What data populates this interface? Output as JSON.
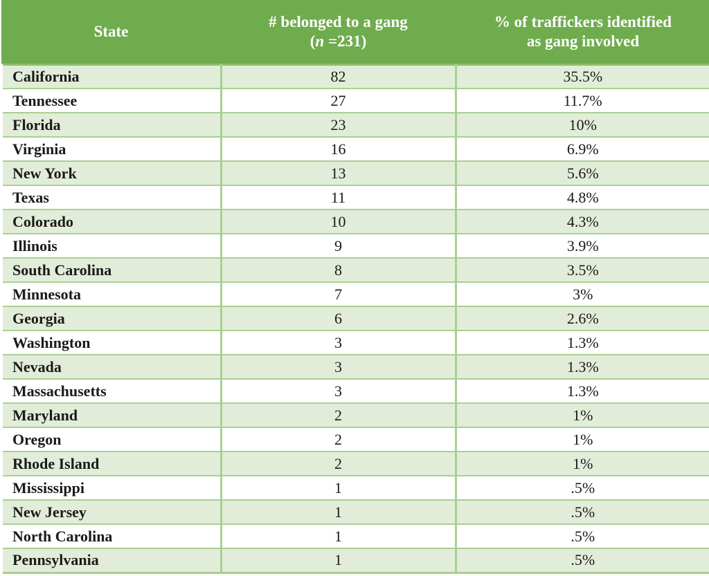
{
  "table": {
    "columns": [
      {
        "key": "state",
        "header_lines": [
          "State"
        ],
        "align": "left"
      },
      {
        "key": "count",
        "header_lines": [
          "# belonged to a gang",
          "(n =231)"
        ],
        "header_line2_prefix": "(",
        "header_line2_italic": "n",
        "header_line2_suffix": " =231)",
        "align": "center"
      },
      {
        "key": "percent",
        "header_lines": [
          "% of traffickers identified",
          "as gang involved"
        ],
        "align": "center"
      }
    ],
    "sample_size": "231",
    "colors": {
      "header_green": "#6fac4d",
      "row_alt_green": "#e2edd9",
      "row_base_white": "#ffffff",
      "gridline_green": "#a9cf92",
      "header_text": "#ffffff",
      "body_text": "#1a1a1a"
    },
    "rows": [
      {
        "state": "California",
        "count": "82",
        "percent": "35.5%"
      },
      {
        "state": "Tennessee",
        "count": "27",
        "percent": "11.7%"
      },
      {
        "state": "Florida",
        "count": "23",
        "percent": "10%"
      },
      {
        "state": "Virginia",
        "count": "16",
        "percent": "6.9%"
      },
      {
        "state": "New York",
        "count": "13",
        "percent": "5.6%"
      },
      {
        "state": "Texas",
        "count": "11",
        "percent": "4.8%"
      },
      {
        "state": "Colorado",
        "count": "10",
        "percent": "4.3%"
      },
      {
        "state": "Illinois",
        "count": "9",
        "percent": "3.9%"
      },
      {
        "state": "South Carolina",
        "count": "8",
        "percent": "3.5%"
      },
      {
        "state": "Minnesota",
        "count": "7",
        "percent": "3%"
      },
      {
        "state": "Georgia",
        "count": "6",
        "percent": "2.6%"
      },
      {
        "state": "Washington",
        "count": "3",
        "percent": "1.3%"
      },
      {
        "state": "Nevada",
        "count": "3",
        "percent": "1.3%"
      },
      {
        "state": "Massachusetts",
        "count": "3",
        "percent": "1.3%"
      },
      {
        "state": "Maryland",
        "count": "2",
        "percent": "1%"
      },
      {
        "state": "Oregon",
        "count": "2",
        "percent": "1%"
      },
      {
        "state": "Rhode Island",
        "count": "2",
        "percent": "1%"
      },
      {
        "state": "Mississippi",
        "count": "1",
        "percent": ".5%"
      },
      {
        "state": "New Jersey",
        "count": "1",
        "percent": ".5%"
      },
      {
        "state": "North Carolina",
        "count": "1",
        "percent": ".5%"
      },
      {
        "state": "Pennsylvania",
        "count": "1",
        "percent": ".5%"
      }
    ]
  },
  "chart_data": {
    "type": "table",
    "title": "",
    "columns": [
      "State",
      "# belonged to a gang (n =231)",
      "% of traffickers identified as gang involved"
    ],
    "categories": [
      "California",
      "Tennessee",
      "Florida",
      "Virginia",
      "New York",
      "Texas",
      "Colorado",
      "Illinois",
      "South Carolina",
      "Minnesota",
      "Georgia",
      "Washington",
      "Nevada",
      "Massachusetts",
      "Maryland",
      "Oregon",
      "Rhode Island",
      "Mississippi",
      "New Jersey",
      "North Carolina",
      "Pennsylvania"
    ],
    "series": [
      {
        "name": "# belonged to a gang",
        "values": [
          82,
          27,
          23,
          16,
          13,
          11,
          10,
          9,
          8,
          7,
          6,
          3,
          3,
          3,
          2,
          2,
          2,
          1,
          1,
          1,
          1
        ]
      },
      {
        "name": "% of traffickers identified as gang involved",
        "values": [
          35.5,
          11.7,
          10,
          6.9,
          5.6,
          4.8,
          4.3,
          3.9,
          3.5,
          3,
          2.6,
          1.3,
          1.3,
          1.3,
          1,
          1,
          1,
          0.5,
          0.5,
          0.5,
          0.5
        ]
      }
    ],
    "total_n": 231,
    "xlabel": "State",
    "ylabel": ""
  }
}
